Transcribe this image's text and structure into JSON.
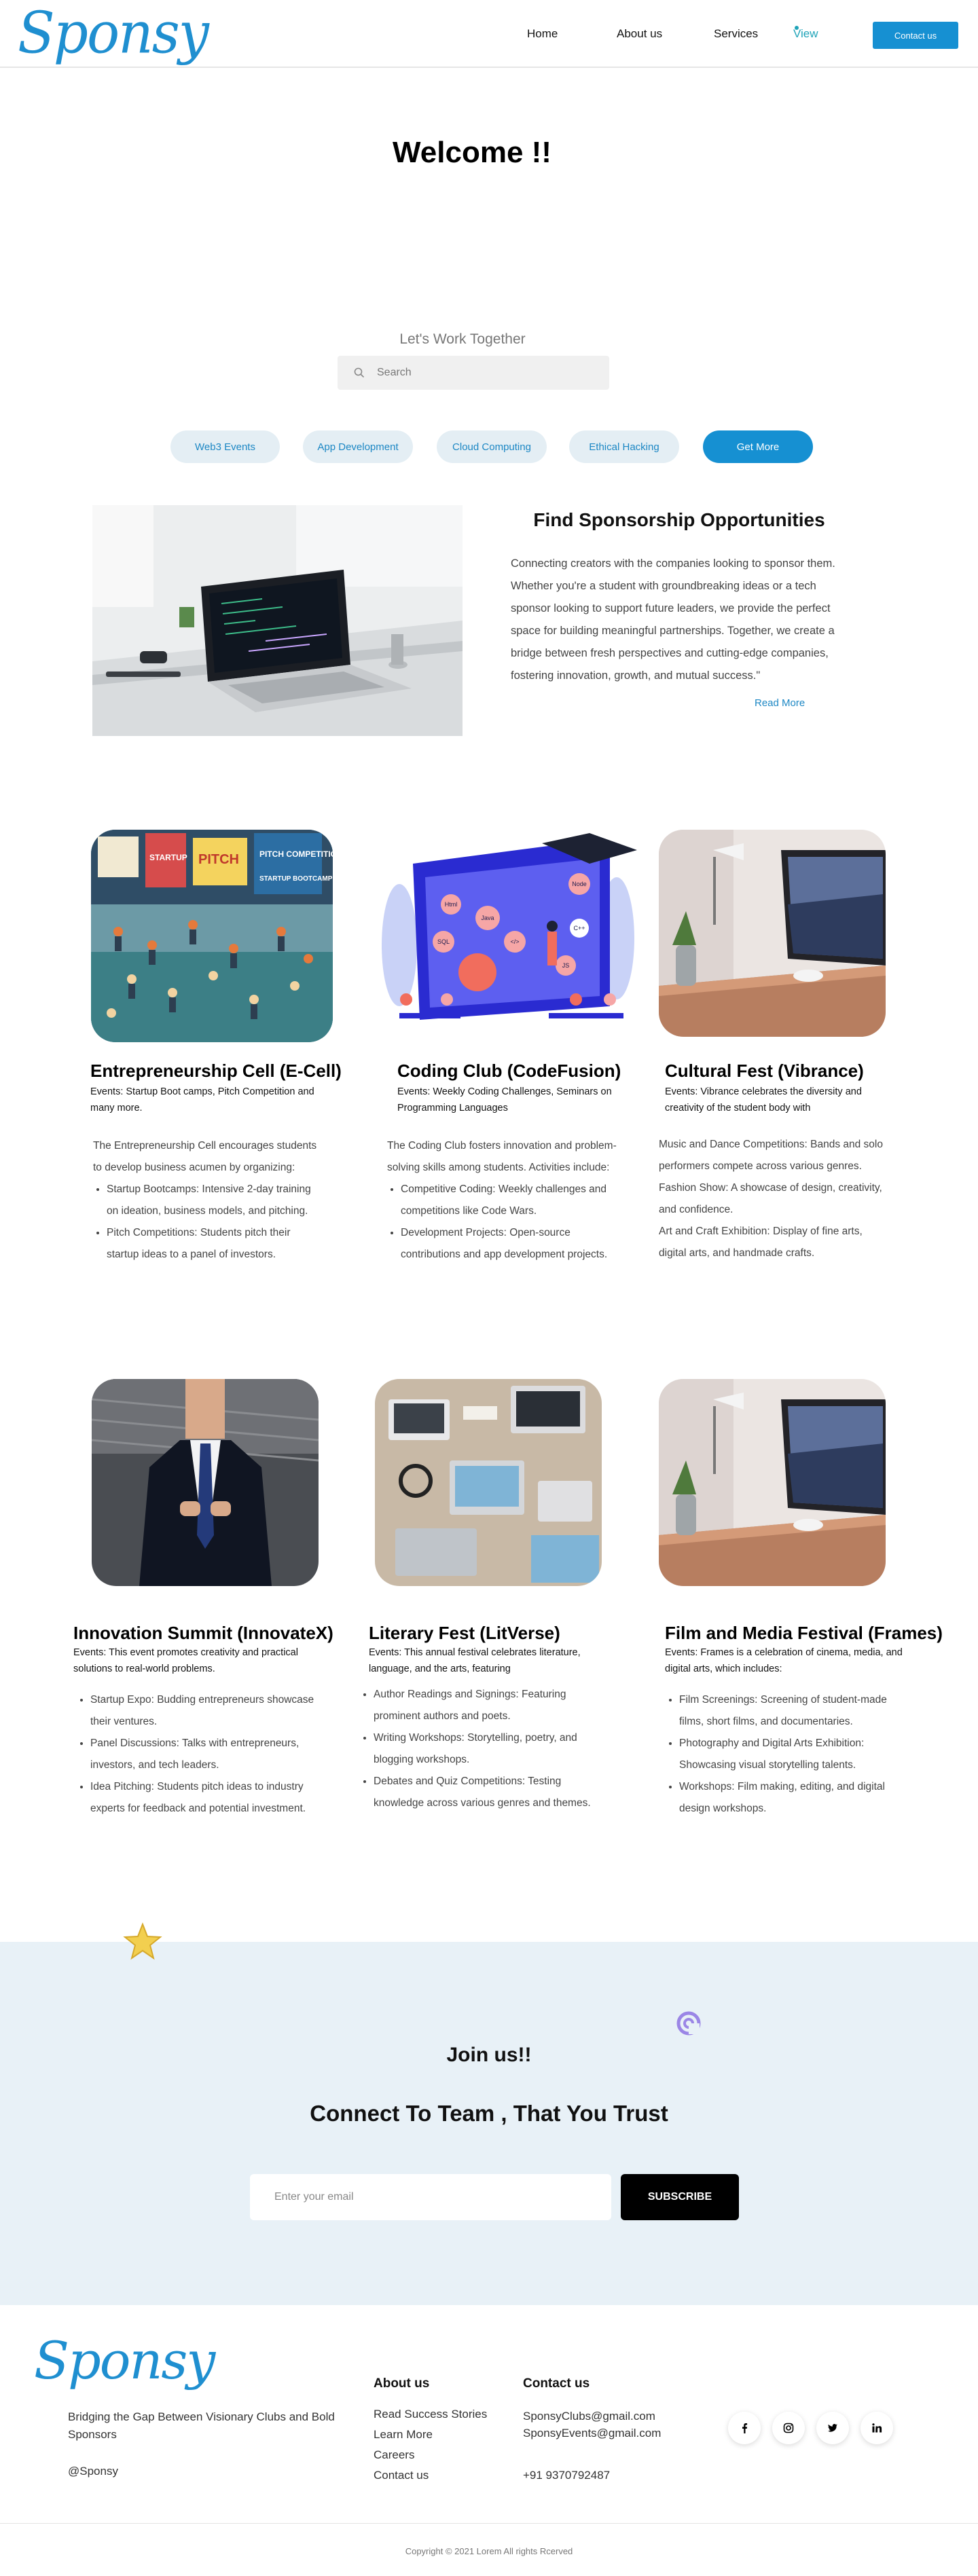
{
  "header": {
    "logo": "Sponsy",
    "nav": [
      "Home",
      "About us",
      "Services",
      "View"
    ],
    "contact_label": "Contact us"
  },
  "welcome": {
    "title": "Welcome !!",
    "subtitle": "Let's Work Together",
    "search_placeholder": "Search"
  },
  "categories": [
    "Web3 Events",
    "App Development",
    "Cloud Computing",
    "Ethical Hacking"
  ],
  "get_more_label": "Get More",
  "sponsorship": {
    "title": "Find Sponsorship Opportunities",
    "text": "Connecting creators with the companies looking to sponsor them. Whether you're a student with groundbreaking ideas or a tech sponsor looking to support future leaders, we provide the perfect space for building meaningful partnerships. Together, we create a bridge between fresh perspectives and cutting-edge companies, fostering innovation, growth, and mutual success.\"",
    "read_more": "Read More"
  },
  "clubs": [
    {
      "title": "Entrepreneurship Cell (E-Cell)",
      "events": "Events: Startup Boot camps, Pitch Competition and many more.",
      "intro": "The Entrepreneurship Cell encourages students to develop business acumen by organizing:",
      "bullets": [
        "Startup Bootcamps: Intensive 2-day training on ideation, business models, and pitching.",
        "Pitch Competitions: Students pitch their startup ideas to a panel of investors."
      ],
      "image_labels": [
        "STARTUP",
        "PITCH",
        "PITCH COMPETITION",
        "STARTUP BOOTCAMP"
      ]
    },
    {
      "title": "Coding Club (CodeFusion)",
      "events": "Events: Weekly Coding Challenges, Seminars on Programming Languages",
      "intro": "The Coding Club fosters innovation and problem-solving skills among students. Activities include:",
      "bullets": [
        "Competitive Coding: Weekly challenges and competitions like Code Wars.",
        "Development Projects: Open-source contributions and app development projects."
      ],
      "image_labels": [
        "Html",
        "Java",
        "Node",
        "SQL",
        "C++",
        "JS",
        "</>"
      ]
    },
    {
      "title": "Cultural Fest (Vibrance)",
      "events": "Events: Vibrance celebrates the diversity and creativity of the student body with",
      "paragraphs": [
        "Music and Dance Competitions: Bands and solo performers compete across various genres.",
        "Fashion Show: A showcase of design, creativity, and confidence.",
        "Art and Craft Exhibition: Display of fine arts, digital arts, and handmade crafts."
      ]
    },
    {
      "title": "Innovation Summit (InnovateX)",
      "events": "Events: This event promotes creativity and practical solutions to real-world problems.",
      "bullets": [
        "Startup Expo: Budding entrepreneurs showcase their ventures.",
        "Panel Discussions: Talks with entrepreneurs, investors, and tech leaders.",
        "Idea Pitching: Students pitch ideas to industry experts for feedback and potential investment."
      ]
    },
    {
      "title": "Literary Fest (LitVerse)",
      "events": "Events: This annual festival celebrates literature, language, and the arts, featuring",
      "bullets": [
        "Author Readings and Signings: Featuring prominent authors and poets.",
        "Writing Workshops: Storytelling, poetry, and blogging workshops.",
        "Debates and Quiz Competitions: Testing knowledge across various genres and themes."
      ]
    },
    {
      "title": "Film and Media Festival (Frames)",
      "events": "Events: Frames is a celebration of cinema, media, and digital arts, which includes:",
      "bullets": [
        "Film Screenings: Screening of student-made films, short films, and documentaries.",
        "Photography and Digital Arts Exhibition: Showcasing visual storytelling talents.",
        "Workshops: Film making, editing, and digital design workshops."
      ]
    }
  ],
  "join": {
    "title": "Join us!!",
    "subtitle": "Connect To Team , That You Trust",
    "email_placeholder": "Enter your email",
    "subscribe_label": "SUBSCRIBE"
  },
  "footer": {
    "logo": "Sponsy",
    "tagline": "Bridging the Gap Between Visionary Clubs and Bold Sponsors",
    "handle": "@Sponsy",
    "about_heading": "About us",
    "about_links": [
      "Read Success Stories",
      "Learn More",
      "Careers",
      "Contact us"
    ],
    "contact_heading": "Contact us",
    "emails": [
      "SponsyClubs@gmail.com",
      "SponsyEvents@gmail.com"
    ],
    "phone": "+91 9370792487",
    "social": [
      "f",
      "ig",
      "tw",
      "in"
    ],
    "copyright": "Copyright © 2021 Lorem All rights Rcerved"
  },
  "colors": {
    "brand": "#1690d2",
    "chip_bg": "#e4eef4",
    "join_bg": "#e8f1f7"
  }
}
